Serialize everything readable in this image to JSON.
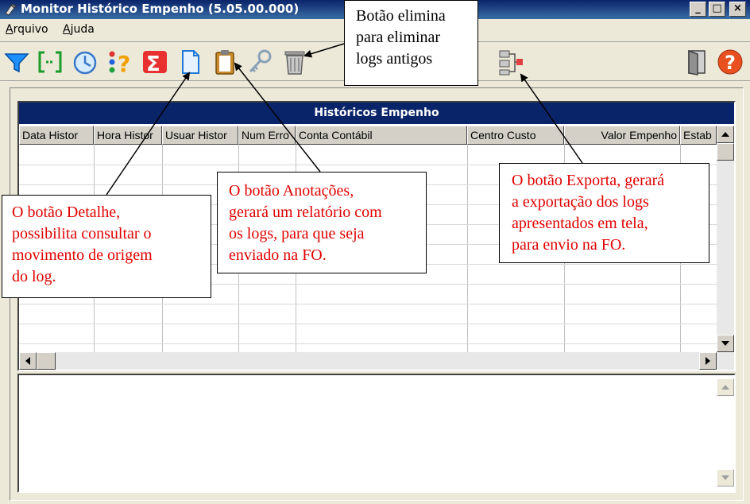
{
  "window": {
    "title": "Monitor Histórico Empenho (5.05.00.000)",
    "buttons": [
      "_",
      "□",
      "×"
    ]
  },
  "menu": [
    {
      "underline": "A",
      "rest": "rquivo"
    },
    {
      "underline": "A",
      "rest": "juda"
    }
  ],
  "toolbar": {
    "buttons": [
      "filter-icon",
      "bracket-select-icon",
      "clock-icon",
      "question-icon",
      "sigma-icon",
      "document-icon",
      "clipboard-icon",
      "key-icon",
      "trash-icon",
      "export-network-icon",
      "exit-door-icon",
      "help-icon"
    ]
  },
  "grid": {
    "title": "Históricos Empenho",
    "columns": [
      "Data Histor",
      "Hora Histor",
      "Usuar Histor",
      "Num Erro",
      "Conta Contábil",
      "Centro Custo",
      "Valor Empenho",
      "Estab"
    ],
    "rows": []
  },
  "memo": {
    "value": ""
  },
  "callouts": {
    "elimina": [
      "Botão elimina",
      "para eliminar",
      "logs antigos"
    ],
    "detalhe": [
      "O botão Detalhe,",
      "possibilita consultar o",
      "movimento de origem",
      "do log."
    ],
    "anotacoes": [
      "O botão Anotações,",
      "gerará um relatório com",
      "os logs, para que seja",
      "enviado na FO."
    ],
    "exporta": [
      "O botão Exporta, gerará",
      "a exportação dos logs",
      "apresentados em tela,",
      "para envio na FO."
    ]
  },
  "colors": {
    "titlebar": "#0a246a",
    "grid_header": "#0a246a",
    "callout_text_red": "#e00000",
    "window_bg": "#ece9d8"
  }
}
